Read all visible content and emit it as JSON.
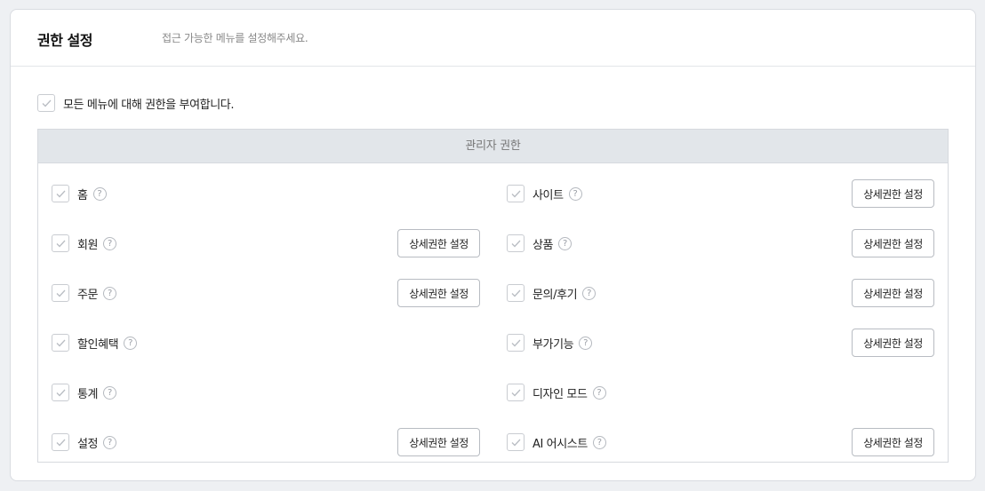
{
  "header": {
    "title": "권한 설정",
    "description": "접근 가능한 메뉴를 설정해주세요."
  },
  "all_menu": {
    "label": "모든 메뉴에 대해 권한을 부여합니다.",
    "checked": true
  },
  "admin_table": {
    "heading": "관리자 권한",
    "detail_button_label": "상세권한 설정",
    "help_glyph": "?",
    "left_column": [
      {
        "label": "홈",
        "has_detail": false,
        "checked": true
      },
      {
        "label": "회원",
        "has_detail": true,
        "checked": true
      },
      {
        "label": "주문",
        "has_detail": true,
        "checked": true
      },
      {
        "label": "할인혜택",
        "has_detail": false,
        "checked": true
      },
      {
        "label": "통계",
        "has_detail": false,
        "checked": true
      },
      {
        "label": "설정",
        "has_detail": true,
        "checked": true
      }
    ],
    "right_column": [
      {
        "label": "사이트",
        "has_detail": true,
        "checked": true
      },
      {
        "label": "상품",
        "has_detail": true,
        "checked": true
      },
      {
        "label": "문의/후기",
        "has_detail": true,
        "checked": true
      },
      {
        "label": "부가기능",
        "has_detail": true,
        "checked": true
      },
      {
        "label": "디자인 모드",
        "has_detail": false,
        "checked": true
      },
      {
        "label": "AI 어시스트",
        "has_detail": true,
        "checked": true
      }
    ]
  }
}
